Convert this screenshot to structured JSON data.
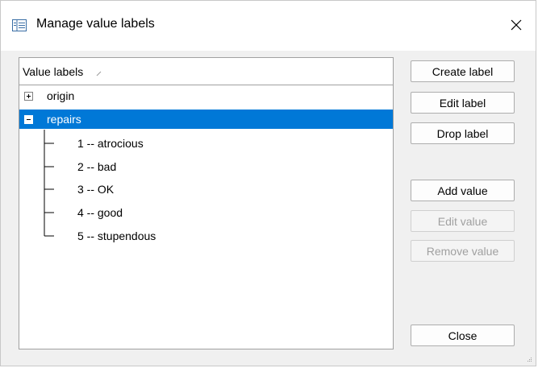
{
  "window": {
    "title": "Manage value labels",
    "icon": "label-manager-icon",
    "close_icon": "close-icon"
  },
  "tree": {
    "column_header": "Value labels",
    "sort_indicator": "sort-ascending-icon",
    "items": [
      {
        "label": "origin",
        "expanded": false,
        "selected": false,
        "children": []
      },
      {
        "label": "repairs",
        "expanded": true,
        "selected": true,
        "children": [
          "1 -- atrocious",
          "2 -- bad",
          "3 -- OK",
          "4 -- good",
          "5 -- stupendous"
        ]
      }
    ]
  },
  "buttons": {
    "create_label": "Create label",
    "edit_label": "Edit label",
    "drop_label": "Drop label",
    "add_value": "Add value",
    "edit_value": "Edit value",
    "remove_value": "Remove value",
    "close": "Close"
  },
  "colors": {
    "selection": "#0078d7",
    "disabled_text": "#a0a0a0"
  }
}
